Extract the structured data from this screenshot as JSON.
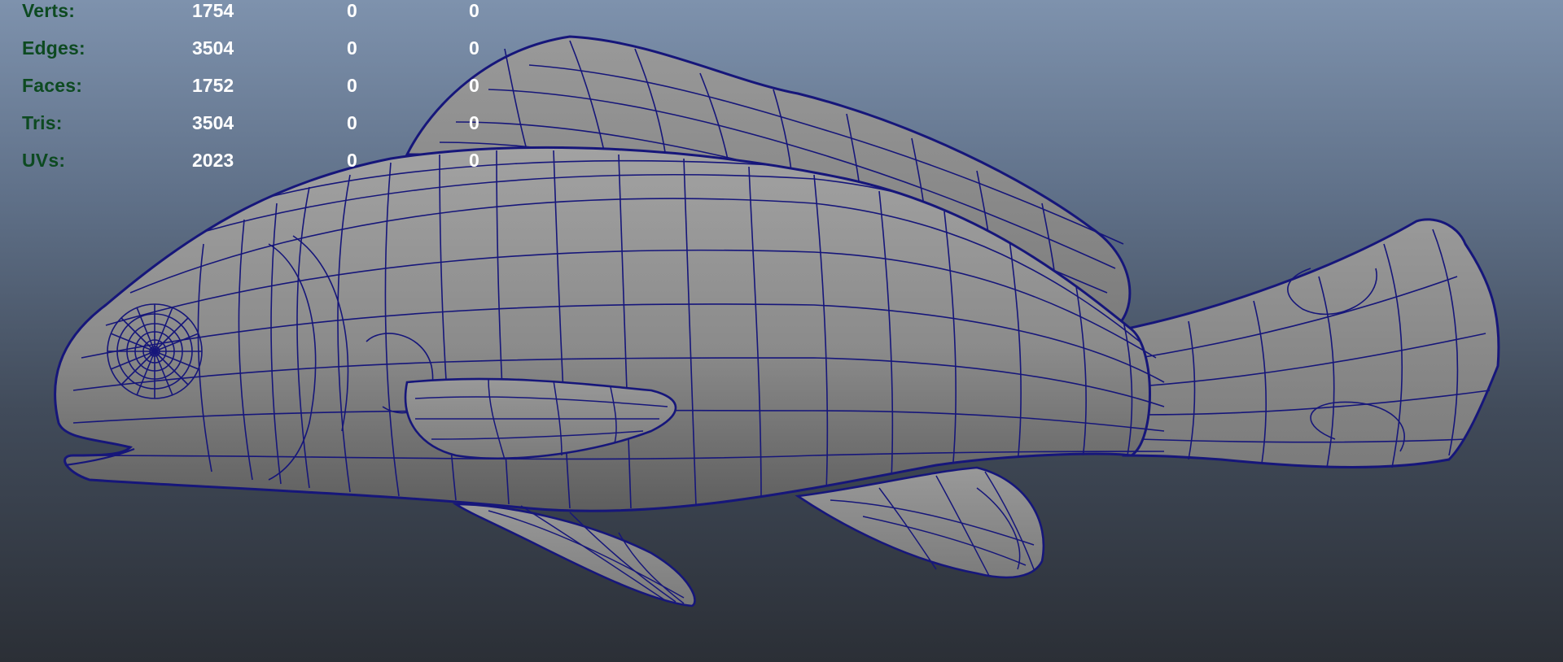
{
  "heads_up_display": {
    "poly_count": [
      {
        "label": "Verts:",
        "object": "1754",
        "selected": "0",
        "uv_selected": "0"
      },
      {
        "label": "Edges:",
        "object": "3504",
        "selected": "0",
        "uv_selected": "0"
      },
      {
        "label": "Faces:",
        "object": "1752",
        "selected": "0",
        "uv_selected": "0"
      },
      {
        "label": "Tris:",
        "object": "3504",
        "selected": "0",
        "uv_selected": "0"
      },
      {
        "label": "UVs:",
        "object": "2023",
        "selected": "0",
        "uv_selected": "0"
      }
    ]
  },
  "colors": {
    "background_top": "#7e92ad",
    "background_bottom": "#2b2f36",
    "hud_label": "#0d4a21",
    "hud_value": "#ffffff",
    "mesh_fill": "#8c8c8c",
    "wireframe": "#16167a"
  },
  "model": {
    "icon": "fish-mesh-icon",
    "display": "wireframe-on-shaded"
  }
}
